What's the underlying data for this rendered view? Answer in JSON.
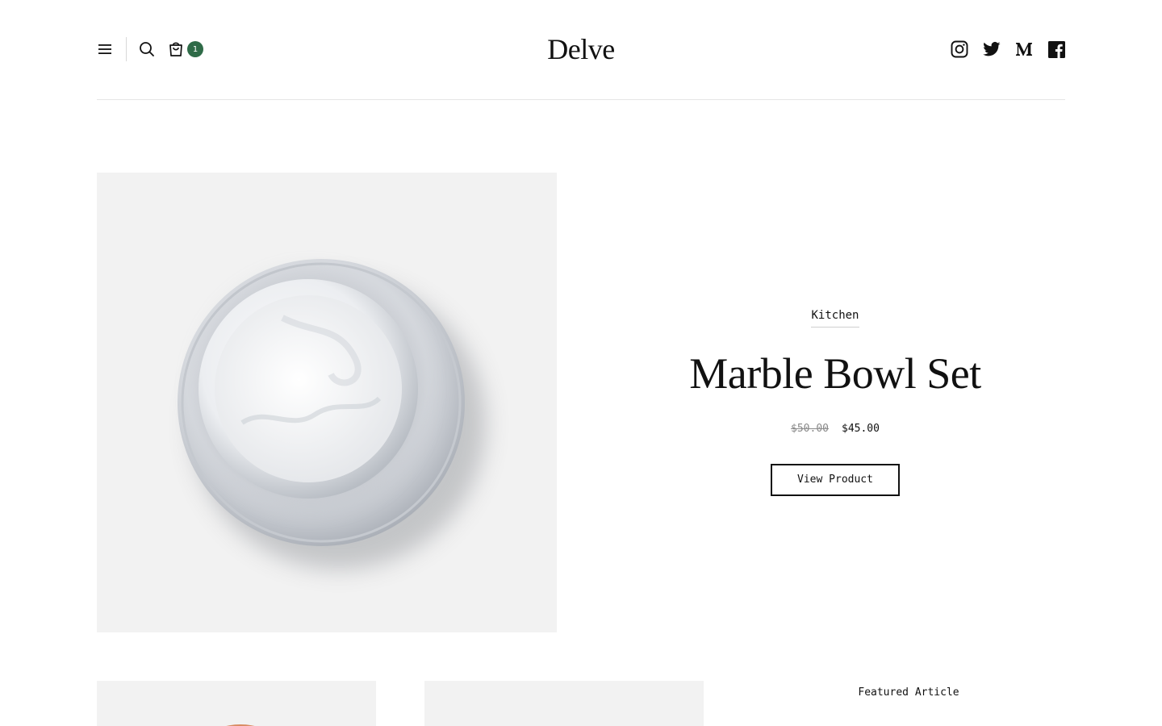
{
  "header": {
    "logo": "Delve",
    "cart_count": "1",
    "icons": {
      "menu": "hamburger-menu-icon",
      "search": "search-icon",
      "cart": "shopping-bag-icon",
      "social": [
        "instagram-icon",
        "twitter-icon",
        "medium-icon",
        "facebook-icon"
      ]
    }
  },
  "hero": {
    "category": "Kitchen",
    "title": "Marble Bowl Set",
    "price_original": "$50.00",
    "price_sale": "$45.00",
    "cta_label": "View Product",
    "image": "marble-bowl-set-photo"
  },
  "featured": {
    "label": "Featured Article"
  },
  "colors": {
    "accent": "#2f6b48",
    "image_bg": "#f2f2f2",
    "text": "#111111",
    "muted": "#8a8a8a"
  }
}
